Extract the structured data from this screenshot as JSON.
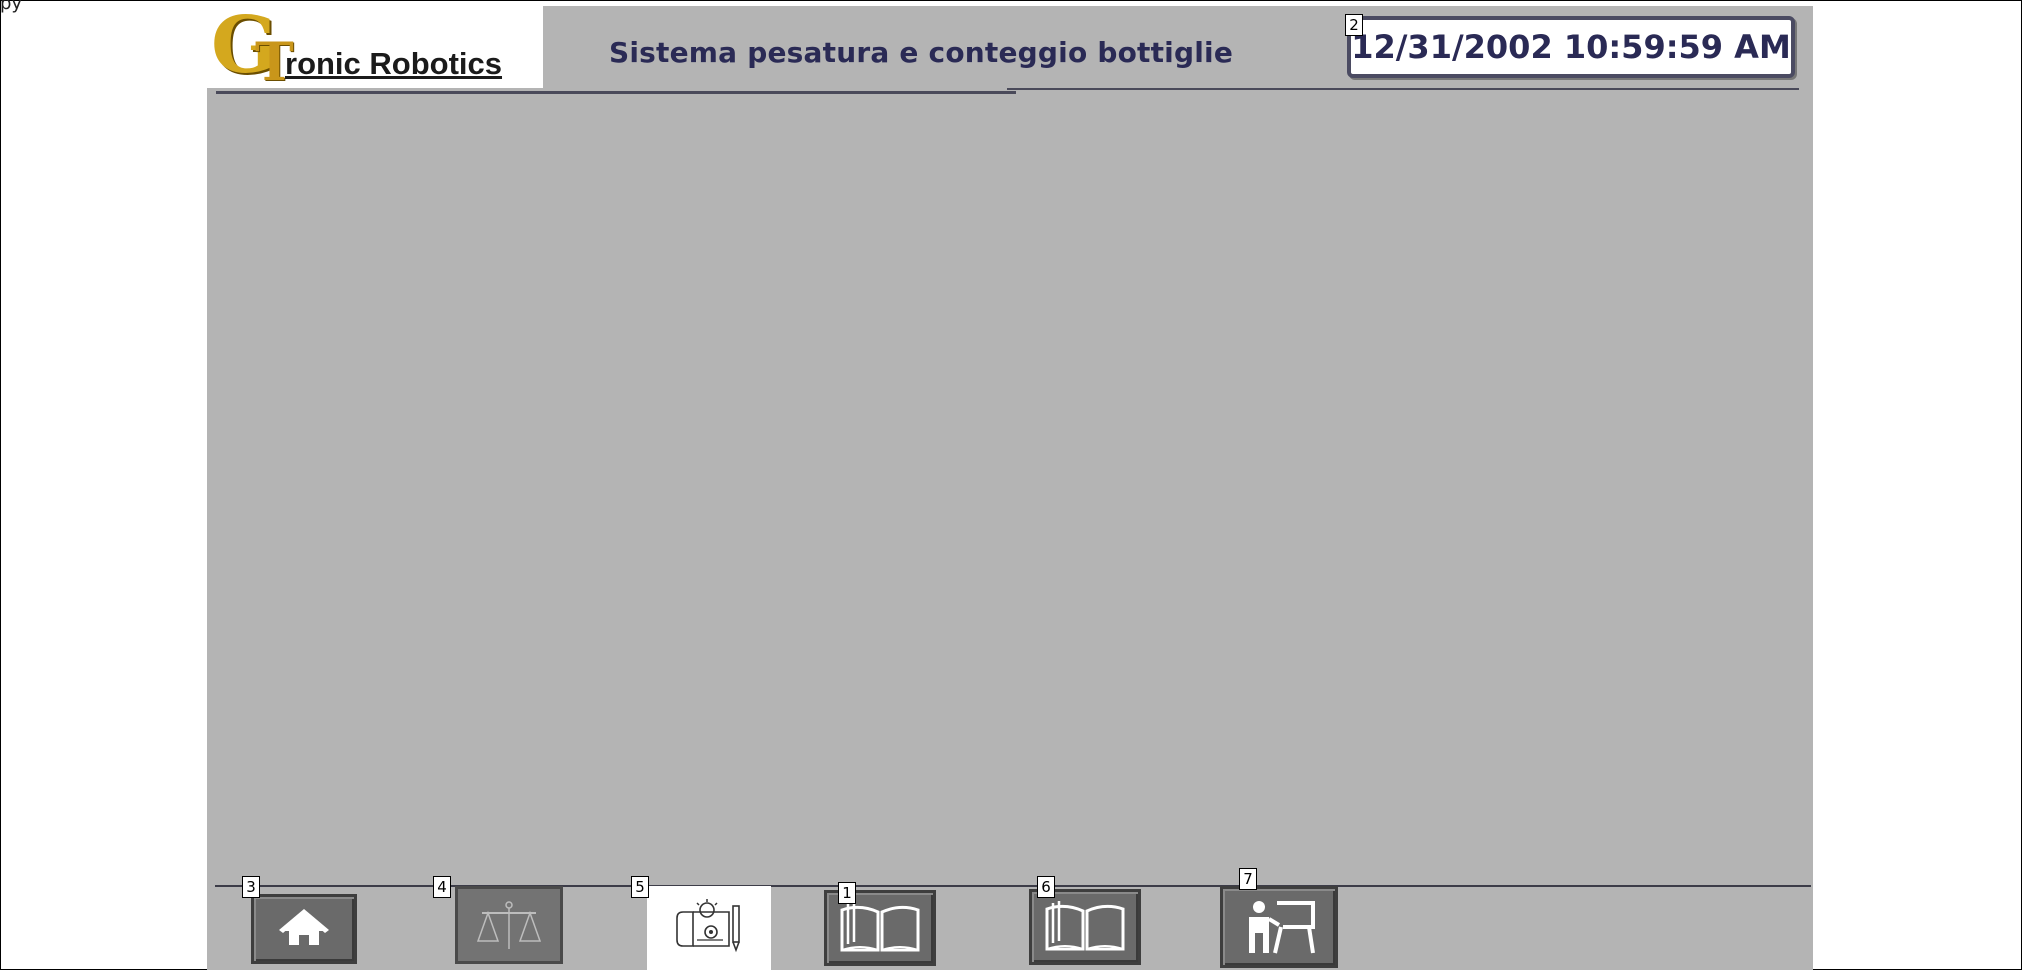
{
  "crop_text": "py",
  "header": {
    "logo_letter_g": "G",
    "logo_letter_t": "T",
    "logo_text": "ronic Robotics",
    "title": "Sistema pesatura e conteggio bottiglie",
    "datetime": "12/31/2002 10:59:59 AM"
  },
  "badges": {
    "datetime": "2",
    "home": "3",
    "scale": "4",
    "design": "5",
    "book_a": "1",
    "book_b": "6",
    "teacher": "7"
  },
  "nav_icons": [
    "home-icon",
    "scale-icon",
    "design-ideas-icon",
    "book-icon",
    "book-icon",
    "teacher-icon"
  ],
  "colors": {
    "screen_bg": "#b4b4b4",
    "button_bg": "#6a6a6a",
    "title_text": "#2a2a55",
    "logo_gold": "#d4a81e"
  }
}
